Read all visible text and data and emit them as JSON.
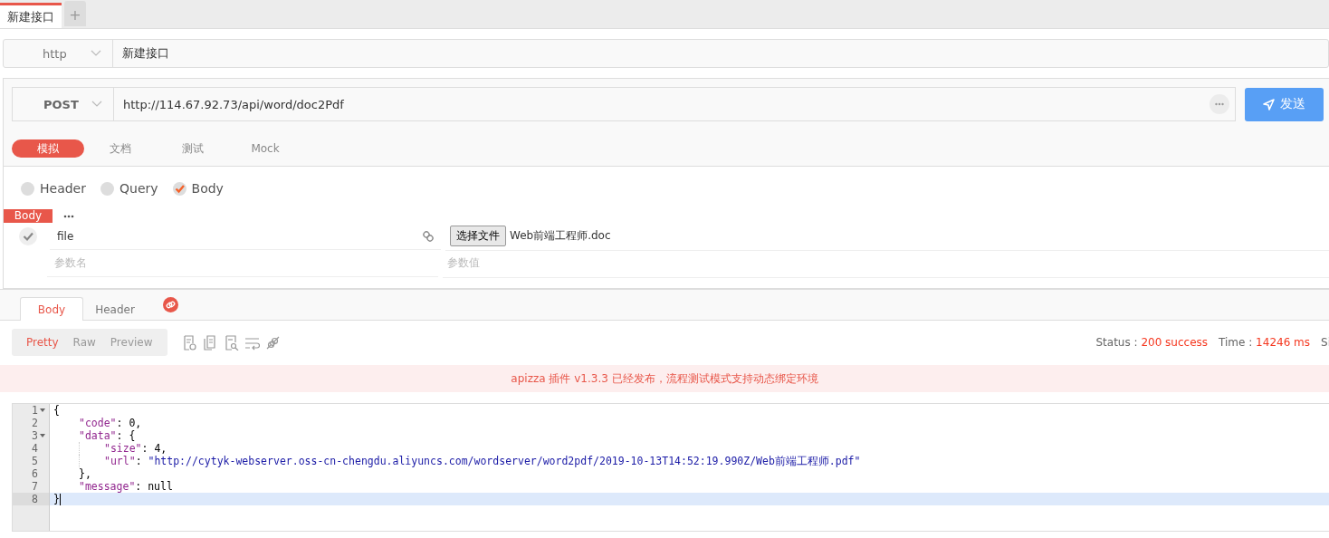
{
  "tabs": [
    {
      "label": "新建接口",
      "kind": "page",
      "selected": true
    },
    {
      "label": "+",
      "kind": "add"
    }
  ],
  "protocol": {
    "value": "http"
  },
  "interface_name": {
    "value": "新建接口"
  },
  "request": {
    "method": "POST",
    "url": "http://114.67.92.73/api/word/doc2Pdf",
    "send_button": "发送"
  },
  "mode_tabs": [
    {
      "label": "模拟",
      "selected": true
    },
    {
      "label": "文档",
      "selected": false
    },
    {
      "label": "测试",
      "selected": false
    },
    {
      "label": "Mock",
      "selected": false
    }
  ],
  "param_types": [
    {
      "label": "Header",
      "checked": false
    },
    {
      "label": "Query",
      "checked": false
    },
    {
      "label": "Body",
      "checked": true
    }
  ],
  "body": {
    "label": "Body",
    "params": [
      {
        "name": "file",
        "file_button": "选择文件",
        "value": "Web前端工程师.doc",
        "enabled": true
      }
    ],
    "name_placeholder": "参数名",
    "value_placeholder": "参数值"
  },
  "response": {
    "tabs": [
      {
        "label": "Body",
        "selected": true
      },
      {
        "label": "Header",
        "selected": false
      }
    ],
    "view_tabs": [
      {
        "label": "Pretty",
        "selected": true
      },
      {
        "label": "Raw",
        "selected": false
      },
      {
        "label": "Preview",
        "selected": false
      }
    ],
    "status_label": "Status :",
    "status": "200 success",
    "time_label": "Time :",
    "time": "14246 ms",
    "size_label": "Si",
    "notice": "apizza 插件 v1.3.3 已经发布，流程测试模式支持动态绑定环境",
    "code": [
      {
        "number": "1",
        "foldable": true,
        "active": false,
        "tokens": [
          {
            "kind": "punct",
            "text": "{"
          }
        ],
        "children": [
          {
            "number": "2",
            "foldable": false,
            "active": false,
            "tokens": [
              {
                "kind": "key",
                "text": "\"code\""
              },
              {
                "kind": "punct",
                "text": ": "
              },
              {
                "kind": "number",
                "text": "0"
              },
              {
                "kind": "punct",
                "text": ","
              }
            ]
          },
          {
            "number": "3",
            "foldable": true,
            "active": false,
            "tokens": [
              {
                "kind": "key",
                "text": "\"data\""
              },
              {
                "kind": "punct",
                "text": ": {"
              }
            ],
            "children": [
              {
                "number": "4",
                "foldable": false,
                "active": false,
                "tokens": [
                  {
                    "kind": "key",
                    "text": "\"size\""
                  },
                  {
                    "kind": "punct",
                    "text": ": "
                  },
                  {
                    "kind": "number",
                    "text": "4"
                  },
                  {
                    "kind": "punct",
                    "text": ","
                  }
                ]
              },
              {
                "number": "5",
                "foldable": false,
                "active": false,
                "tokens": [
                  {
                    "kind": "key",
                    "text": "\"url\""
                  },
                  {
                    "kind": "punct",
                    "text": ": "
                  },
                  {
                    "kind": "string",
                    "text": "\"http://cytyk-webserver.oss-cn-chengdu.aliyuncs.com/wordserver/word2pdf/2019-10-13T14:52:19.990Z/Web前端工程师.pdf\""
                  }
                ]
              }
            ]
          },
          {
            "number": "6",
            "foldable": false,
            "active": false,
            "tokens": [
              {
                "kind": "punct",
                "text": "},"
              }
            ]
          },
          {
            "number": "7",
            "foldable": false,
            "active": false,
            "tokens": [
              {
                "kind": "key",
                "text": "\"message\""
              },
              {
                "kind": "punct",
                "text": ": "
              },
              {
                "kind": "null",
                "text": "null"
              }
            ]
          }
        ]
      },
      {
        "number": "8",
        "foldable": false,
        "active": true,
        "tokens": [
          {
            "kind": "punct",
            "text": "}"
          }
        ]
      }
    ]
  }
}
